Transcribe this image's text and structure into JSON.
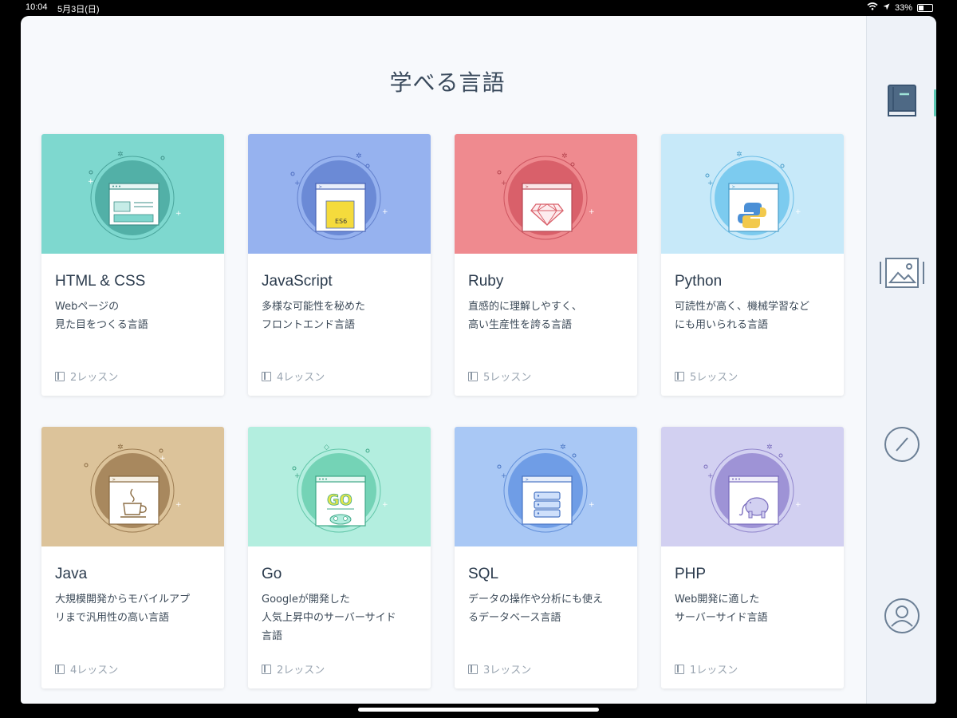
{
  "status": {
    "time": "10:04",
    "date": "5月3日(日)",
    "battery": "33%"
  },
  "page": {
    "title": "学べる言語"
  },
  "cards": [
    {
      "name": "HTML & CSS",
      "desc1": "Webページの",
      "desc2": "見た目をつくる言語",
      "desc3": "",
      "lessons": "2レッスン",
      "color": "#7ed8cf",
      "circle": "#52b0a7",
      "icon": "webpage-icon"
    },
    {
      "name": "JavaScript",
      "desc1": "多様な可能性を秘めた",
      "desc2": "フロントエンド言語",
      "desc3": "",
      "lessons": "4レッスン",
      "color": "#96b2ef",
      "circle": "#6b8ad6",
      "icon": "es6-icon",
      "badge": "ES6"
    },
    {
      "name": "Ruby",
      "desc1": "直感的に理解しやすく、",
      "desc2": "高い生産性を誇る言語",
      "desc3": "",
      "lessons": "5レッスン",
      "color": "#ef8a8f",
      "circle": "#d9606a",
      "icon": "ruby-gem-icon"
    },
    {
      "name": "Python",
      "desc1": "可読性が高く、機械学習など",
      "desc2": "にも用いられる言語",
      "desc3": "",
      "lessons": "5レッスン",
      "color": "#c7e9f9",
      "circle": "#7ccbef",
      "icon": "python-logo-icon"
    },
    {
      "name": "Java",
      "desc1": "大規模開発からモバイルアプ",
      "desc2": "リまで汎用性の高い言語",
      "desc3": "",
      "lessons": "4レッスン",
      "color": "#dcc39a",
      "circle": "#a8885e",
      "icon": "coffee-cup-icon"
    },
    {
      "name": "Go",
      "desc1": "Googleが開発した",
      "desc2": "人気上昇中のサーバーサイド",
      "desc3": "言語",
      "lessons": "2レッスン",
      "color": "#b3eedf",
      "circle": "#74d3b6",
      "icon": "go-gopher-icon",
      "badge": "GO"
    },
    {
      "name": "SQL",
      "desc1": "データの操作や分析にも使え",
      "desc2": "るデータベース言語",
      "desc3": "",
      "lessons": "3レッスン",
      "color": "#a9c8f5",
      "circle": "#6f9de6",
      "icon": "database-icon"
    },
    {
      "name": "PHP",
      "desc1": "Web開発に適した",
      "desc2": "サーバーサイド言語",
      "desc3": "",
      "lessons": "1レッスン",
      "color": "#d2d0f1",
      "circle": "#9e93d6",
      "icon": "elephant-icon"
    }
  ],
  "sidebar": {
    "items": [
      {
        "icon": "book-icon",
        "active": true
      },
      {
        "icon": "image-icon",
        "active": false
      },
      {
        "icon": "compass-icon",
        "active": false
      },
      {
        "icon": "user-icon",
        "active": false
      }
    ]
  }
}
